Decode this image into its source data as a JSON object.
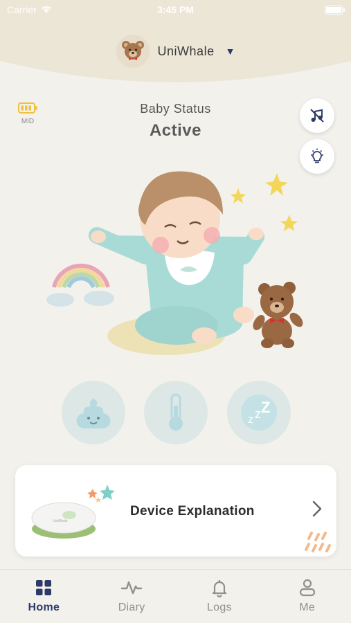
{
  "status_bar": {
    "carrier": "Carrier",
    "time": "3:45 PM"
  },
  "profile": {
    "name": "UniWhale"
  },
  "battery": {
    "label": "MID"
  },
  "baby_status": {
    "title": "Baby Status",
    "value": "Active"
  },
  "card": {
    "title": "Device Explanation"
  },
  "tabs": [
    {
      "label": "Home",
      "active": true
    },
    {
      "label": "Diary",
      "active": false
    },
    {
      "label": "Logs",
      "active": false
    },
    {
      "label": "Me",
      "active": false
    }
  ],
  "colors": {
    "accent": "#2c3a6a",
    "header_bg": "#ece6d6",
    "page_bg": "#f3f1ec",
    "battery": "#f0c040",
    "status_circle": "#dde8e6"
  }
}
